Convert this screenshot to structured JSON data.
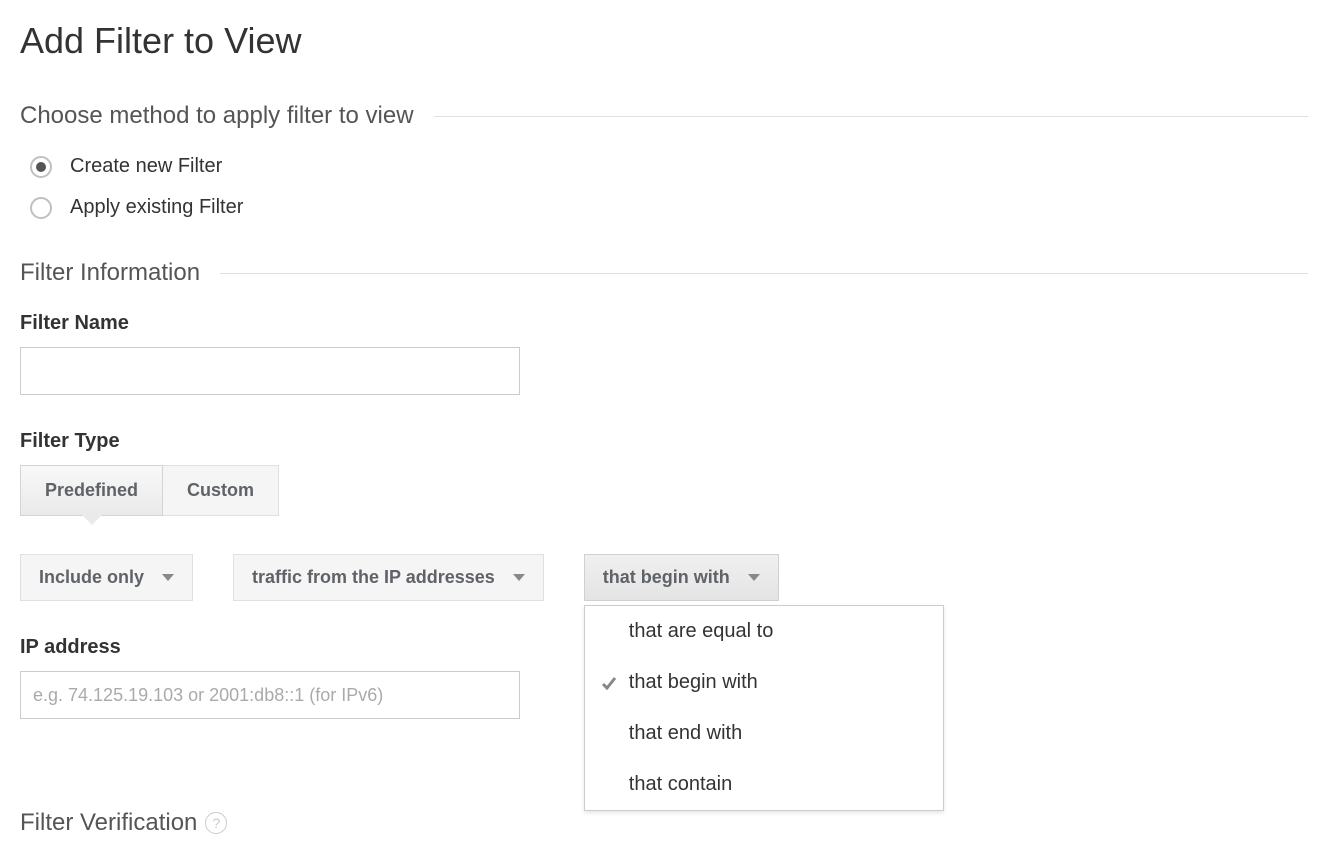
{
  "page": {
    "title": "Add Filter to View"
  },
  "method_section": {
    "title": "Choose method to apply filter to view",
    "options": [
      {
        "label": "Create new Filter",
        "selected": true
      },
      {
        "label": "Apply existing Filter",
        "selected": false
      }
    ]
  },
  "info_section": {
    "title": "Filter Information",
    "filter_name_label": "Filter Name",
    "filter_name_value": "",
    "filter_type_label": "Filter Type",
    "tabs": {
      "predefined": "Predefined",
      "custom": "Custom",
      "active": "predefined"
    },
    "dropdowns": {
      "include": "Include only",
      "traffic": "traffic from the IP addresses",
      "match": "that begin with"
    },
    "match_menu": {
      "options": [
        "that are equal to",
        "that begin with",
        "that end with",
        "that contain"
      ],
      "selected": "that begin with"
    },
    "ip_label": "IP address",
    "ip_placeholder": "e.g. 74.125.19.103 or 2001:db8::1 (for IPv6)",
    "ip_value": ""
  },
  "verification_section": {
    "title": "Filter Verification",
    "help_icon": "?"
  }
}
